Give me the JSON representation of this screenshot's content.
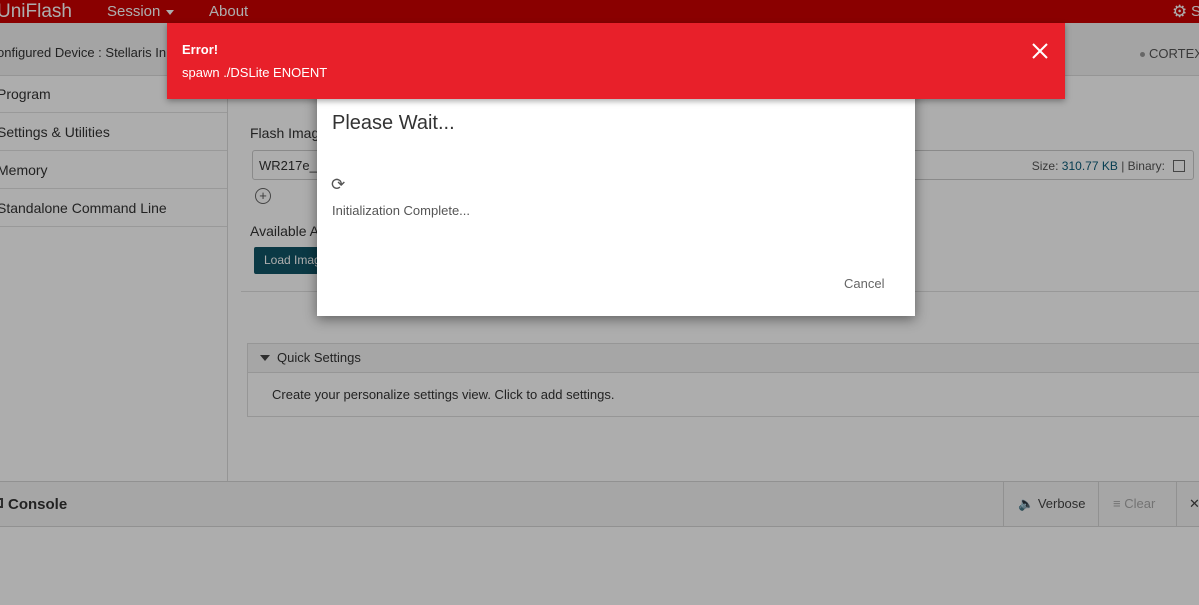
{
  "app": {
    "brand": "UniFlash"
  },
  "menu": {
    "session": "Session",
    "about": "About",
    "settings_partial": "S"
  },
  "device_bar": {
    "configured_device": "onfigured Device : Stellaris In",
    "core": "CORTEX"
  },
  "sidebar": {
    "items": [
      {
        "label": "Program"
      },
      {
        "label": "Settings & Utilities"
      },
      {
        "label": "Memory"
      },
      {
        "label": "Standalone Command Line"
      }
    ]
  },
  "main": {
    "flash_images_label": "Flash Imag",
    "file_name": "WR217e_C",
    "size_label": "Size:",
    "size_value": "310.77 KB",
    "binary_label": "| Binary:",
    "available_label": "Available A",
    "load_button": "Load Imag",
    "add_icon": "plus-circle-icon"
  },
  "quick_settings": {
    "title": "Quick Settings",
    "body": "Create your personalize settings view. Click to add settings."
  },
  "console": {
    "title": "Console",
    "verbose": "Verbose",
    "clear": "Clear",
    "close": "✕"
  },
  "dialog": {
    "title": "Please Wait...",
    "message": "Initialization Complete...",
    "cancel": "Cancel",
    "spinner_icon": "refresh-icon"
  },
  "toast": {
    "title": "Error!",
    "message": "spawn ./DSLite ENOENT",
    "color": "#e8202a"
  },
  "colors": {
    "topbar": "#cc0000",
    "accent": "#115566"
  }
}
